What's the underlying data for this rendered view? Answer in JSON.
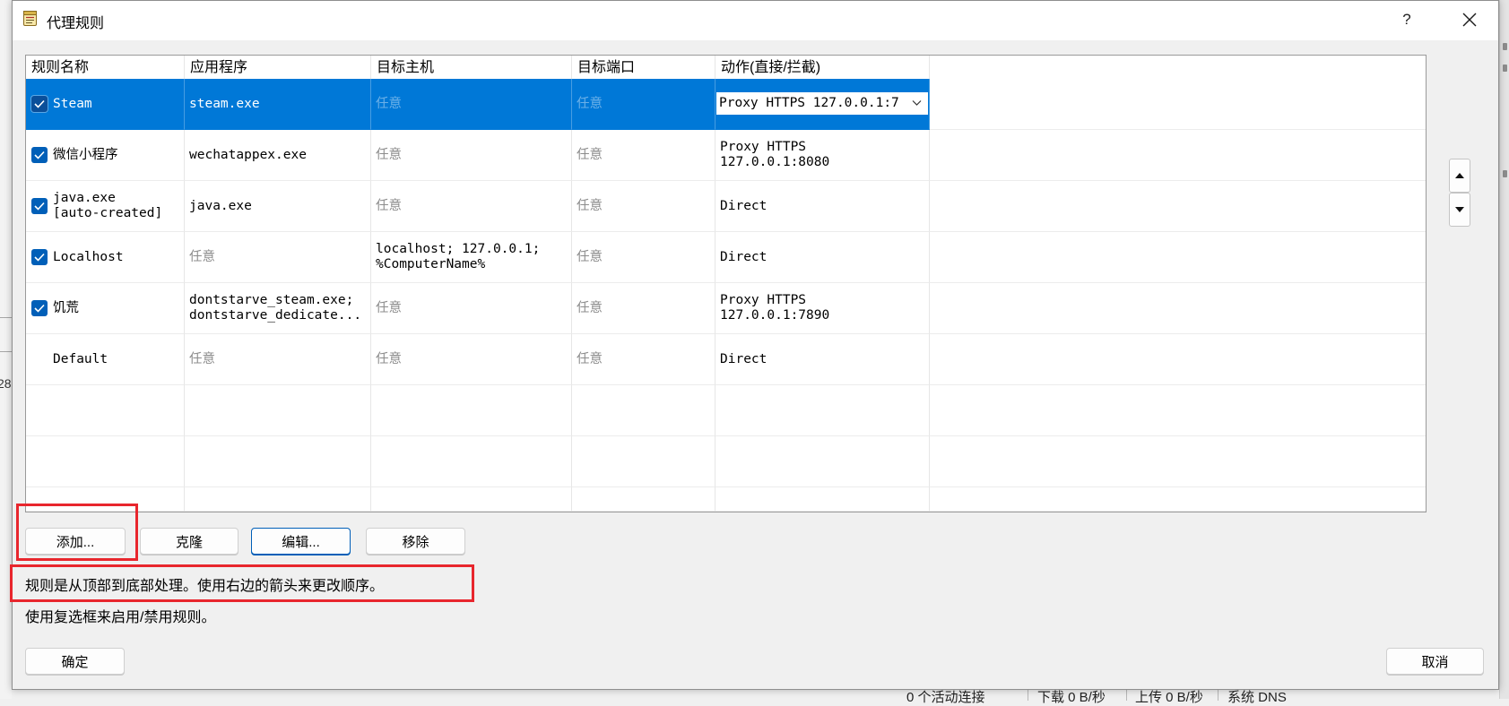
{
  "window": {
    "title": "代理规则",
    "help_label": "?",
    "title_icon": "rules-notebook-icon",
    "close_icon": "close-icon"
  },
  "table": {
    "columns": [
      "规则名称",
      "应用程序",
      "目标主机",
      "目标端口",
      "动作(直接/拦截)"
    ],
    "rows": [
      {
        "checked": true,
        "selected": true,
        "name": "Steam",
        "applications": "steam.exe",
        "target_hosts": "任意",
        "target_ports": "任意",
        "action": "Proxy HTTPS 127.0.0.1:7"
      },
      {
        "checked": true,
        "name": "微信小程序",
        "applications": "wechatappex.exe",
        "target_hosts": "任意",
        "target_ports": "任意",
        "action": "Proxy HTTPS\n127.0.0.1:8080"
      },
      {
        "checked": true,
        "name": "java.exe\n[auto-created]",
        "applications": "java.exe",
        "target_hosts": "任意",
        "target_ports": "任意",
        "action": "Direct"
      },
      {
        "checked": true,
        "name": "Localhost",
        "applications": "任意",
        "target_hosts": "localhost; 127.0.0.1;\n%ComputerName%",
        "target_ports": "任意",
        "action": "Direct"
      },
      {
        "checked": true,
        "name": "饥荒",
        "applications": "dontstarve_steam.exe;\ndontstarve_dedicate...",
        "target_hosts": "任意",
        "target_ports": "任意",
        "action": "Proxy HTTPS\n127.0.0.1:7890"
      },
      {
        "name": "Default",
        "applications": "任意",
        "target_hosts": "任意",
        "target_ports": "任意",
        "action": "Direct"
      }
    ]
  },
  "reorder": {
    "up_icon": "arrow-up-icon",
    "down_icon": "arrow-down-icon"
  },
  "buttons": {
    "add": "添加...",
    "clone": "克隆",
    "edit": "编辑...",
    "remove": "移除",
    "ok": "确定",
    "cancel": "取消"
  },
  "hints": [
    "规则是从顶部到底部处理。使用右边的箭头来更改顺序。",
    "使用复选框来启用/禁用规则。"
  ],
  "status_bar": [
    "0 个活动连接",
    "下载 0 B/秒",
    "上传 0 B/秒",
    "系统 DNS"
  ],
  "background": {
    "left_text": "28"
  },
  "colors": {
    "selection": "#0078d7",
    "checkbox": "#005fb8",
    "focus_border": "#005fb8",
    "annotation_box": "#e8262d",
    "placeholder_text": "#8c8c8c"
  }
}
